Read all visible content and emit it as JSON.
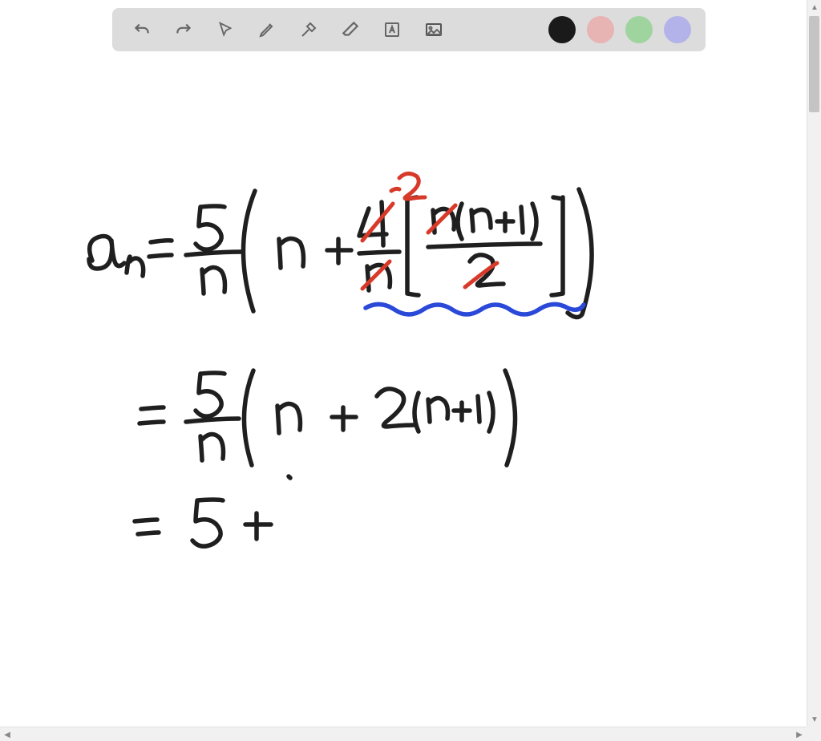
{
  "toolbar": {
    "icons": {
      "undo": "undo-icon",
      "redo": "redo-icon",
      "pointer": "pointer-icon",
      "pencil": "pencil-icon",
      "tools": "tools-icon",
      "eraser": "eraser-icon",
      "text": "text-icon",
      "image": "image-icon"
    },
    "colors": {
      "black": "#1a1a1a",
      "red": "#e8b3b3",
      "green": "#9fd49f",
      "blue": "#b3b3ea"
    }
  },
  "handwriting": {
    "line1": "aₙ = 5/n ( n + 4/n [ n(n+1)/2 ] )",
    "annotation1": "cross out 4, write 2; cross out n and 2 in fraction",
    "line2": "= 5/n ( n + 2(n+1) )",
    "line3": "= 5 +"
  },
  "colors_used": {
    "ink_black": "#1f1f1f",
    "ink_red": "#d83a2a",
    "ink_blue": "#2a49d8"
  }
}
